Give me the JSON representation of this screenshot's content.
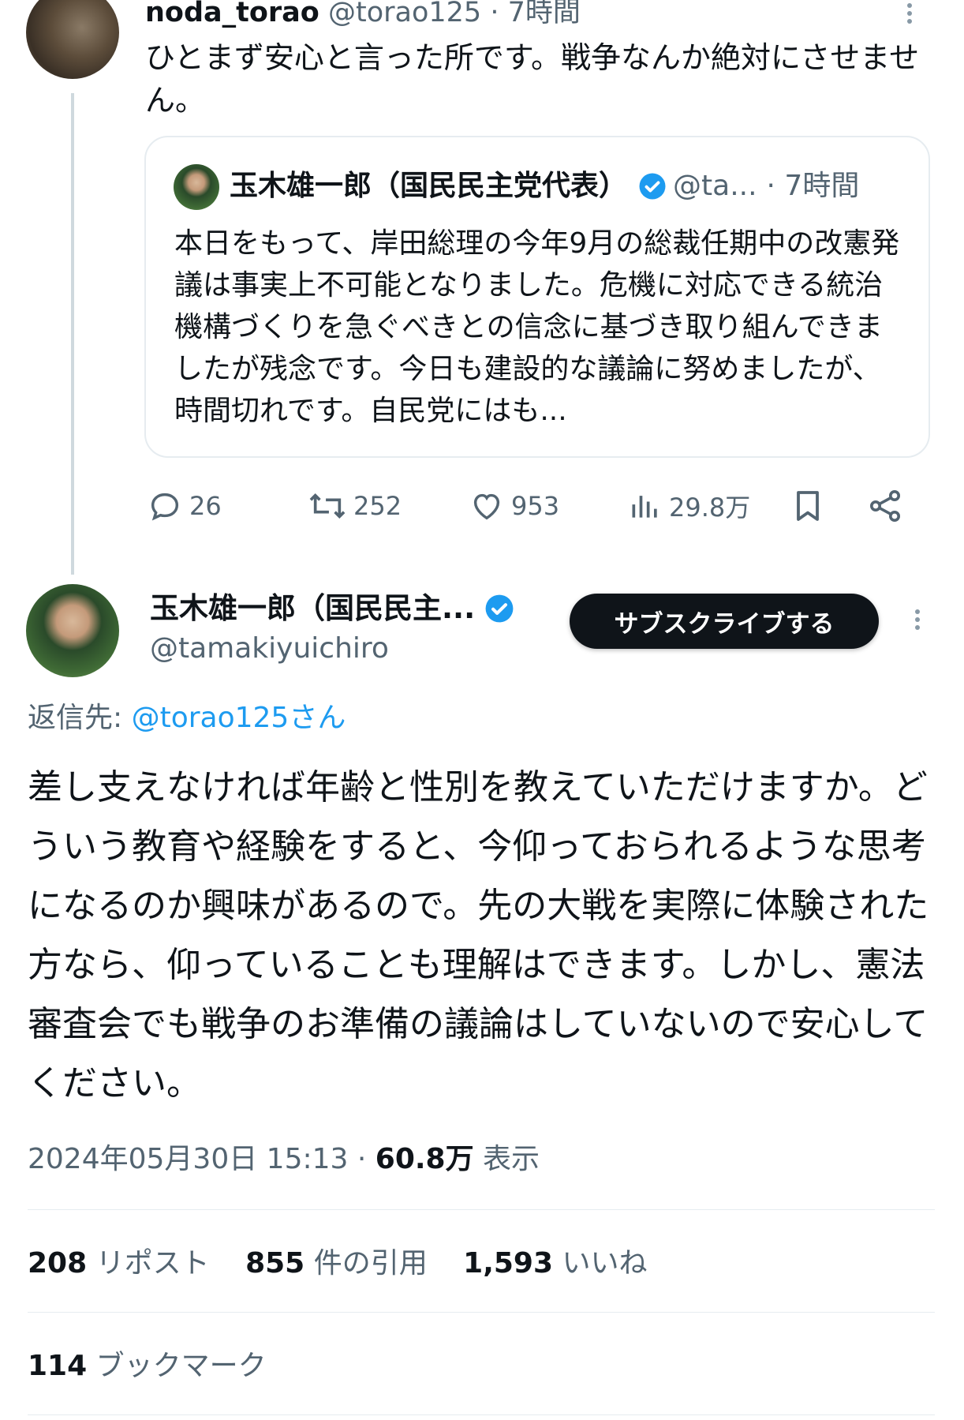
{
  "parent_tweet": {
    "display_name": "noda_torao",
    "handle": "@torao125",
    "time": "· 7時間",
    "text": "ひとまず安心と言った所です。戦争なんか絶対にさせません。"
  },
  "quoted_tweet": {
    "display_name": "玉木雄一郎（国民民主党代表）",
    "handle": "@ta...",
    "time": "· 7時間",
    "text": "本日をもって、岸田総理の今年9月の総裁任期中の改憲発議は事実上不可能となりました。危機に対応できる統治機構づくりを急ぐべきとの信念に基づき取り組んできましたが残念です。今日も建設的な議論に努めましたが、時間切れです。自民党にはも..."
  },
  "parent_actions": {
    "replies": "26",
    "reposts": "252",
    "likes": "953",
    "views": "29.8万"
  },
  "main_tweet": {
    "display_name": "玉木雄一郎（国民民主...",
    "handle": "@tamakiyuichiro",
    "subscribe_label": "サブスクライブする",
    "reply_to_prefix": "返信先: ",
    "reply_to_handle": "@torao125さん",
    "text": "差し支えなければ年齢と性別を教えていただけますか。どういう教育や経験をすると、今仰っておられるような思考になるのか興味があるので。先の大戦を実際に体験された方なら、仰っていることも理解はできます。しかし、憲法審査会でも戦争のお準備の議論はしていないので安心してください。",
    "timestamp": "2024年05月30日 15:13 · ",
    "views_count": "60.8万",
    "views_label": " 表示"
  },
  "stats": {
    "reposts_count": "208",
    "reposts_label": "リポスト",
    "quotes_count": "855",
    "quotes_label": "件の引用",
    "likes_count": "1,593",
    "likes_label": "いいね",
    "bookmarks_count": "114",
    "bookmarks_label": "ブックマーク"
  },
  "icons": [
    "reply-icon",
    "repost-icon",
    "like-icon",
    "views-icon",
    "bookmark-icon",
    "share-icon",
    "verified-icon",
    "more-icon"
  ],
  "colors": {
    "accent": "#1d9bf0",
    "text": "#0f1419",
    "muted": "#536471",
    "border": "#e6ecf0"
  }
}
